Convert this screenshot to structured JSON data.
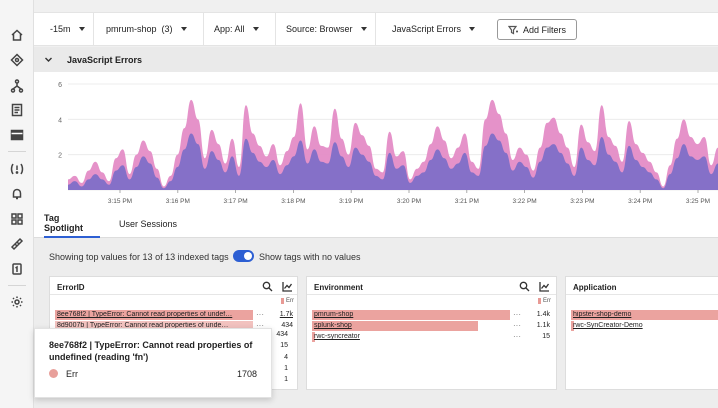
{
  "filter_bar": {
    "time": "-15m",
    "app_name": "pmrum-shop",
    "app_count": "(3)",
    "app_filter": "App: All",
    "source_filter": "Source: Browser",
    "errors_filter": "JavaScript Errors",
    "add_filters": "Add Filters"
  },
  "chart_section": {
    "title": "JavaScript Errors"
  },
  "chart_data": {
    "type": "area",
    "title": "",
    "ylim": [
      0,
      6
    ],
    "yticks": [
      "2",
      "4",
      "6"
    ],
    "xticks": [
      "3:15 PM",
      "3:16 PM",
      "3:17 PM",
      "3:18 PM",
      "3:19 PM",
      "3:20 PM",
      "3:21 PM",
      "3:22 PM",
      "3:23 PM",
      "3:24 PM",
      "3:25 PM"
    ],
    "series": [
      {
        "values": [
          0.6,
          0.8,
          0.4,
          1.1,
          1.6,
          1.0,
          0.5,
          1.8,
          2.3,
          0.9,
          2.0,
          2.8,
          2.2,
          1.2,
          0.2,
          0.8,
          2.0,
          3.5,
          5.1,
          4.0,
          1.8,
          3.4,
          2.6,
          1.5,
          2.9,
          1.3,
          4.8,
          3.2,
          2.5,
          1.9,
          2.6,
          1.4,
          2.2,
          3.0,
          4.9,
          2.3,
          3.6,
          2.5,
          2.4,
          4.6,
          2.9,
          2.0,
          3.8,
          3.1,
          2.5,
          1.2,
          1.0,
          3.3,
          1.9,
          2.2,
          0.6,
          1.2,
          1.6,
          2.6,
          3.6,
          2.8,
          1.8,
          2.4,
          3.2,
          1.6,
          1.2,
          4.0,
          5.1,
          4.3,
          3.2,
          1.7,
          2.4,
          2.0,
          1.1,
          2.4,
          3.8,
          4.1,
          3.2,
          2.4,
          1.3,
          3.7,
          2.7,
          2.2,
          4.8,
          3.0,
          2.5,
          1.6,
          3.9,
          2.6,
          2.1,
          1.6,
          1.0,
          0.2,
          1.4,
          2.9,
          4.0,
          3.0,
          2.6,
          3.0,
          1.4,
          2.4
        ]
      },
      {
        "values": [
          0.3,
          0.5,
          0.2,
          0.6,
          0.9,
          0.6,
          0.3,
          1.1,
          1.4,
          0.6,
          1.3,
          1.9,
          1.5,
          0.7,
          0.1,
          0.5,
          1.3,
          2.3,
          3.2,
          2.6,
          1.2,
          2.2,
          1.7,
          1.0,
          1.9,
          0.8,
          2.9,
          2.1,
          1.6,
          1.3,
          1.7,
          0.9,
          1.4,
          1.9,
          2.8,
          1.5,
          2.3,
          1.6,
          1.5,
          2.7,
          1.9,
          1.3,
          2.4,
          2.0,
          1.6,
          0.8,
          0.6,
          2.1,
          1.2,
          1.4,
          0.4,
          0.8,
          1.0,
          1.7,
          2.3,
          1.8,
          1.2,
          1.5,
          2.1,
          1.0,
          0.8,
          2.5,
          3.2,
          2.8,
          2.1,
          1.1,
          1.6,
          1.3,
          0.7,
          1.6,
          2.4,
          2.6,
          2.1,
          1.5,
          0.8,
          2.4,
          1.7,
          1.4,
          3.0,
          2.0,
          1.6,
          1.0,
          2.5,
          1.7,
          1.3,
          1.0,
          0.6,
          0.1,
          0.9,
          1.8,
          2.6,
          1.9,
          1.7,
          1.9,
          0.9,
          1.5
        ]
      }
    ],
    "colors": [
      "#e48cc6",
      "#7f6fc8"
    ],
    "grid": true
  },
  "tabs": {
    "spotlight": "Tag Spotlight",
    "sessions": "User Sessions"
  },
  "spotlight": {
    "showing": "Showing top values for 13 of 13 indexed tags",
    "toggle_label": "Show tags with no values",
    "err_legend": "Err",
    "cards": {
      "error_id": {
        "title": "ErrorID",
        "rows": [
          {
            "label": "8ee768f2 | TypeError: Cannot read properties of undef…",
            "value": "1.7k"
          },
          {
            "label": "8d9007b | TypeError: Cannot read properties of unde…",
            "value": "434"
          }
        ],
        "hidden_values": [
          "434",
          "15",
          "4",
          "1",
          "1"
        ]
      },
      "environment": {
        "title": "Environment",
        "rows": [
          {
            "label": "pmrum-shop",
            "value": "1.4k"
          },
          {
            "label": "splunk-shop",
            "value": "1.1k"
          },
          {
            "label": "rwc-syncreator",
            "value": "15"
          }
        ]
      },
      "application": {
        "title": "Application",
        "rows": [
          {
            "label": "hipster-shop-demo"
          },
          {
            "label": "rwc-SynCreator-Demo"
          }
        ]
      }
    }
  },
  "tooltip": {
    "title": "8ee768f2 | TypeError: Cannot read properties of undefined (reading 'fn')",
    "series": "Err",
    "value": "1708"
  }
}
